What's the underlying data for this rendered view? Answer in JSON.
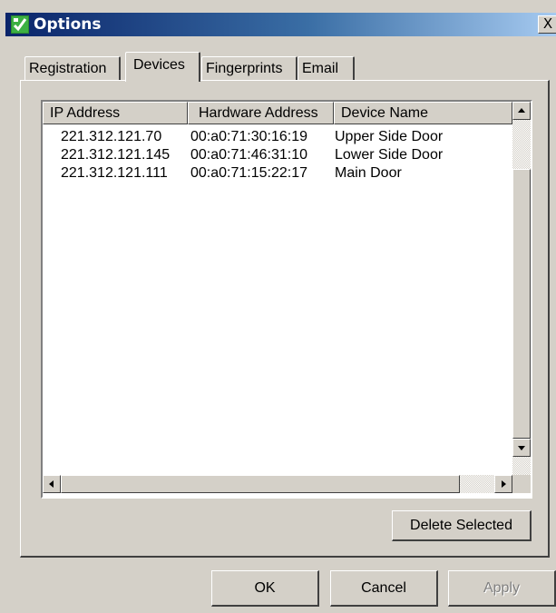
{
  "window": {
    "title": "Options",
    "close_glyph": "X",
    "icon": "fingerprint-app-icon"
  },
  "tabs": [
    {
      "label": "Registration",
      "selected": false
    },
    {
      "label": "Devices",
      "selected": true
    },
    {
      "label": "Fingerprints",
      "selected": false
    },
    {
      "label": "Email",
      "selected": false
    }
  ],
  "device_list": {
    "columns": [
      "IP Address",
      "Hardware Address",
      "Device Name"
    ],
    "rows": [
      [
        "221.312.121.70",
        "00:a0:71:30:16:19",
        "Upper Side Door"
      ],
      [
        "221.312.121.145",
        "00:a0:71:46:31:10",
        "Lower Side Door"
      ],
      [
        "221.312.121.111",
        "00:a0:71:15:22:17",
        "Main Door"
      ]
    ]
  },
  "buttons": {
    "delete_selected": "Delete Selected",
    "ok": "OK",
    "cancel": "Cancel",
    "apply": "Apply"
  },
  "colors": {
    "titlebar_start": "#0a246a",
    "titlebar_end": "#a6caf0",
    "face": "#d4d0c8"
  }
}
